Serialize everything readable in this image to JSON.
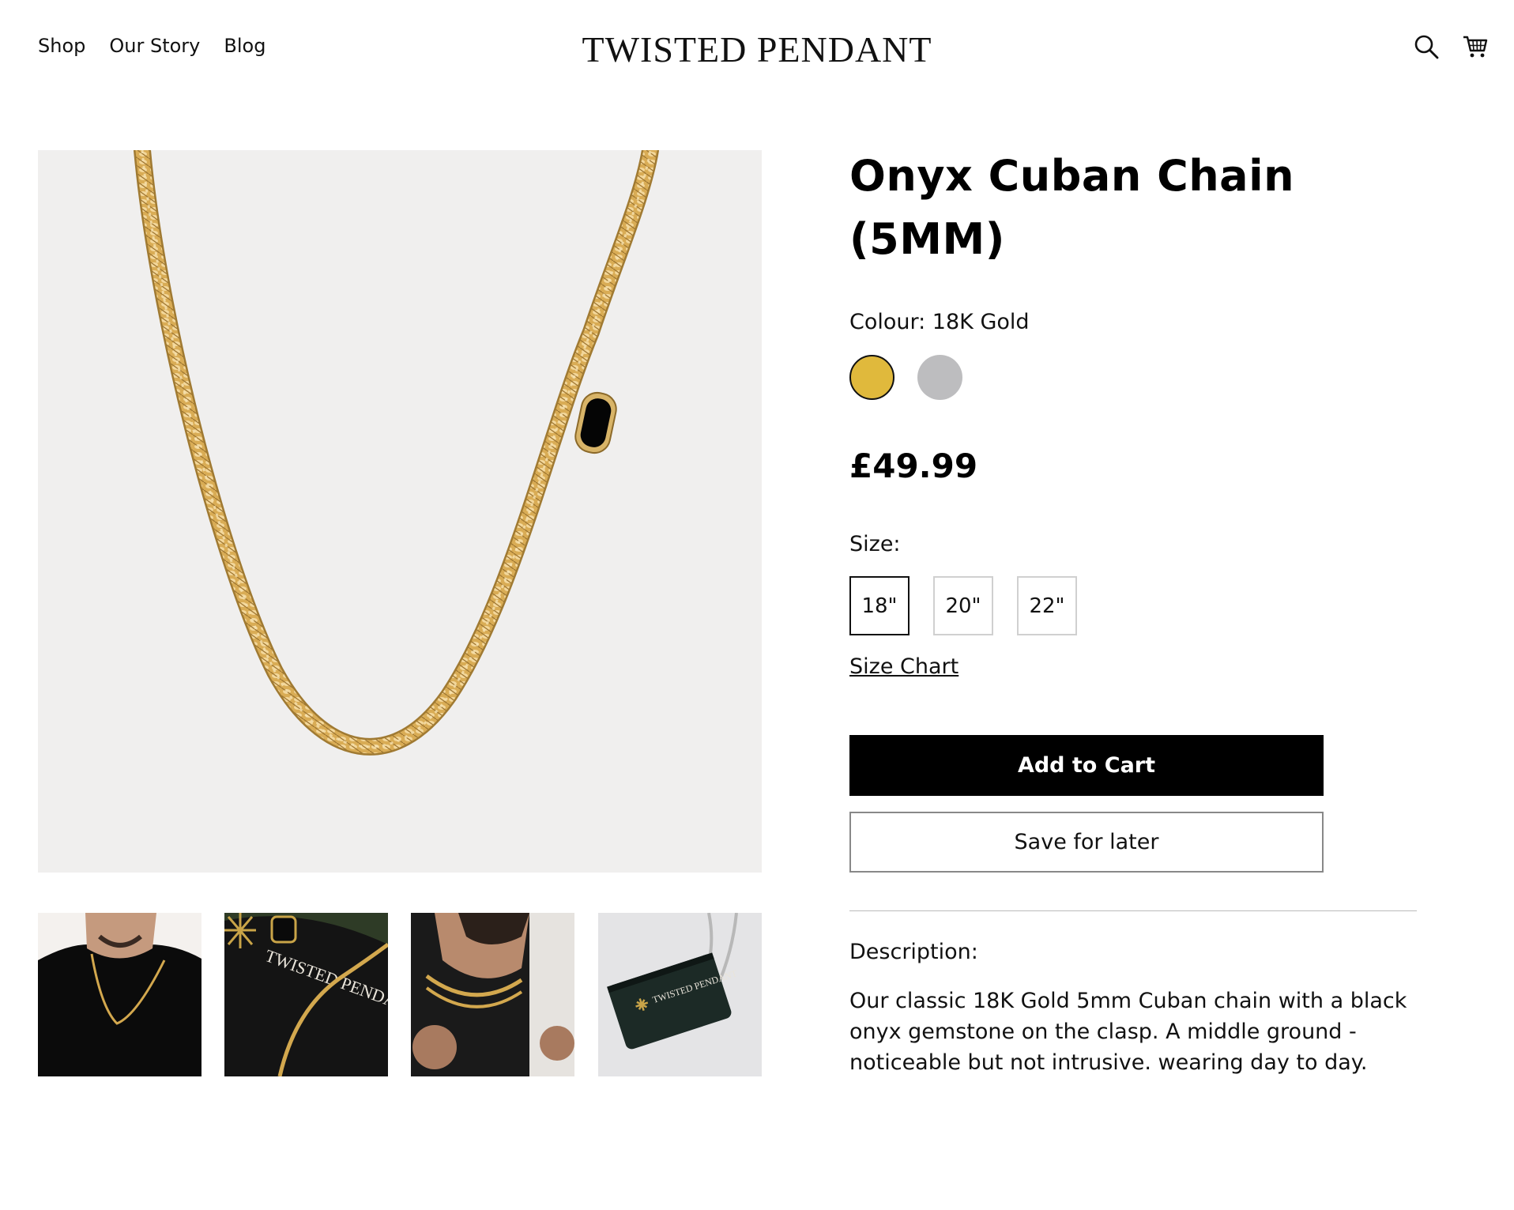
{
  "header": {
    "nav": [
      "Shop",
      "Our Story",
      "Blog"
    ],
    "logo": "TWISTED PENDANT",
    "icons": [
      "search-icon",
      "cart-icon"
    ]
  },
  "gallery": {
    "thumbnails": [
      "model-wearing-chain",
      "chain-on-branded-pouch",
      "model-closeup-chain",
      "branded-pouch-with-chain"
    ],
    "pouch_text": "TWISTED PENDANT"
  },
  "product": {
    "title_line1": "Onyx Cuban Chain",
    "title_line2": "(5MM)",
    "colour_label": "Colour: 18K Gold",
    "colours": [
      {
        "name": "18K Gold",
        "hex": "#e0b93c",
        "selected": true
      },
      {
        "name": "Silver",
        "hex": "#bdbdbf",
        "selected": false
      }
    ],
    "price": "£49.99",
    "size_label": "Size:",
    "sizes": [
      "18\"",
      "20\"",
      "22\""
    ],
    "selected_size": "18\"",
    "size_chart": "Size Chart",
    "add_to_cart": "Add to Cart",
    "save_for_later": "Save for later",
    "description_label": "Description:",
    "description": "Our classic 18K Gold 5mm Cuban chain with a black onyx gemstone on the clasp. A middle ground - noticeable but not intrusive. wearing day to day."
  }
}
